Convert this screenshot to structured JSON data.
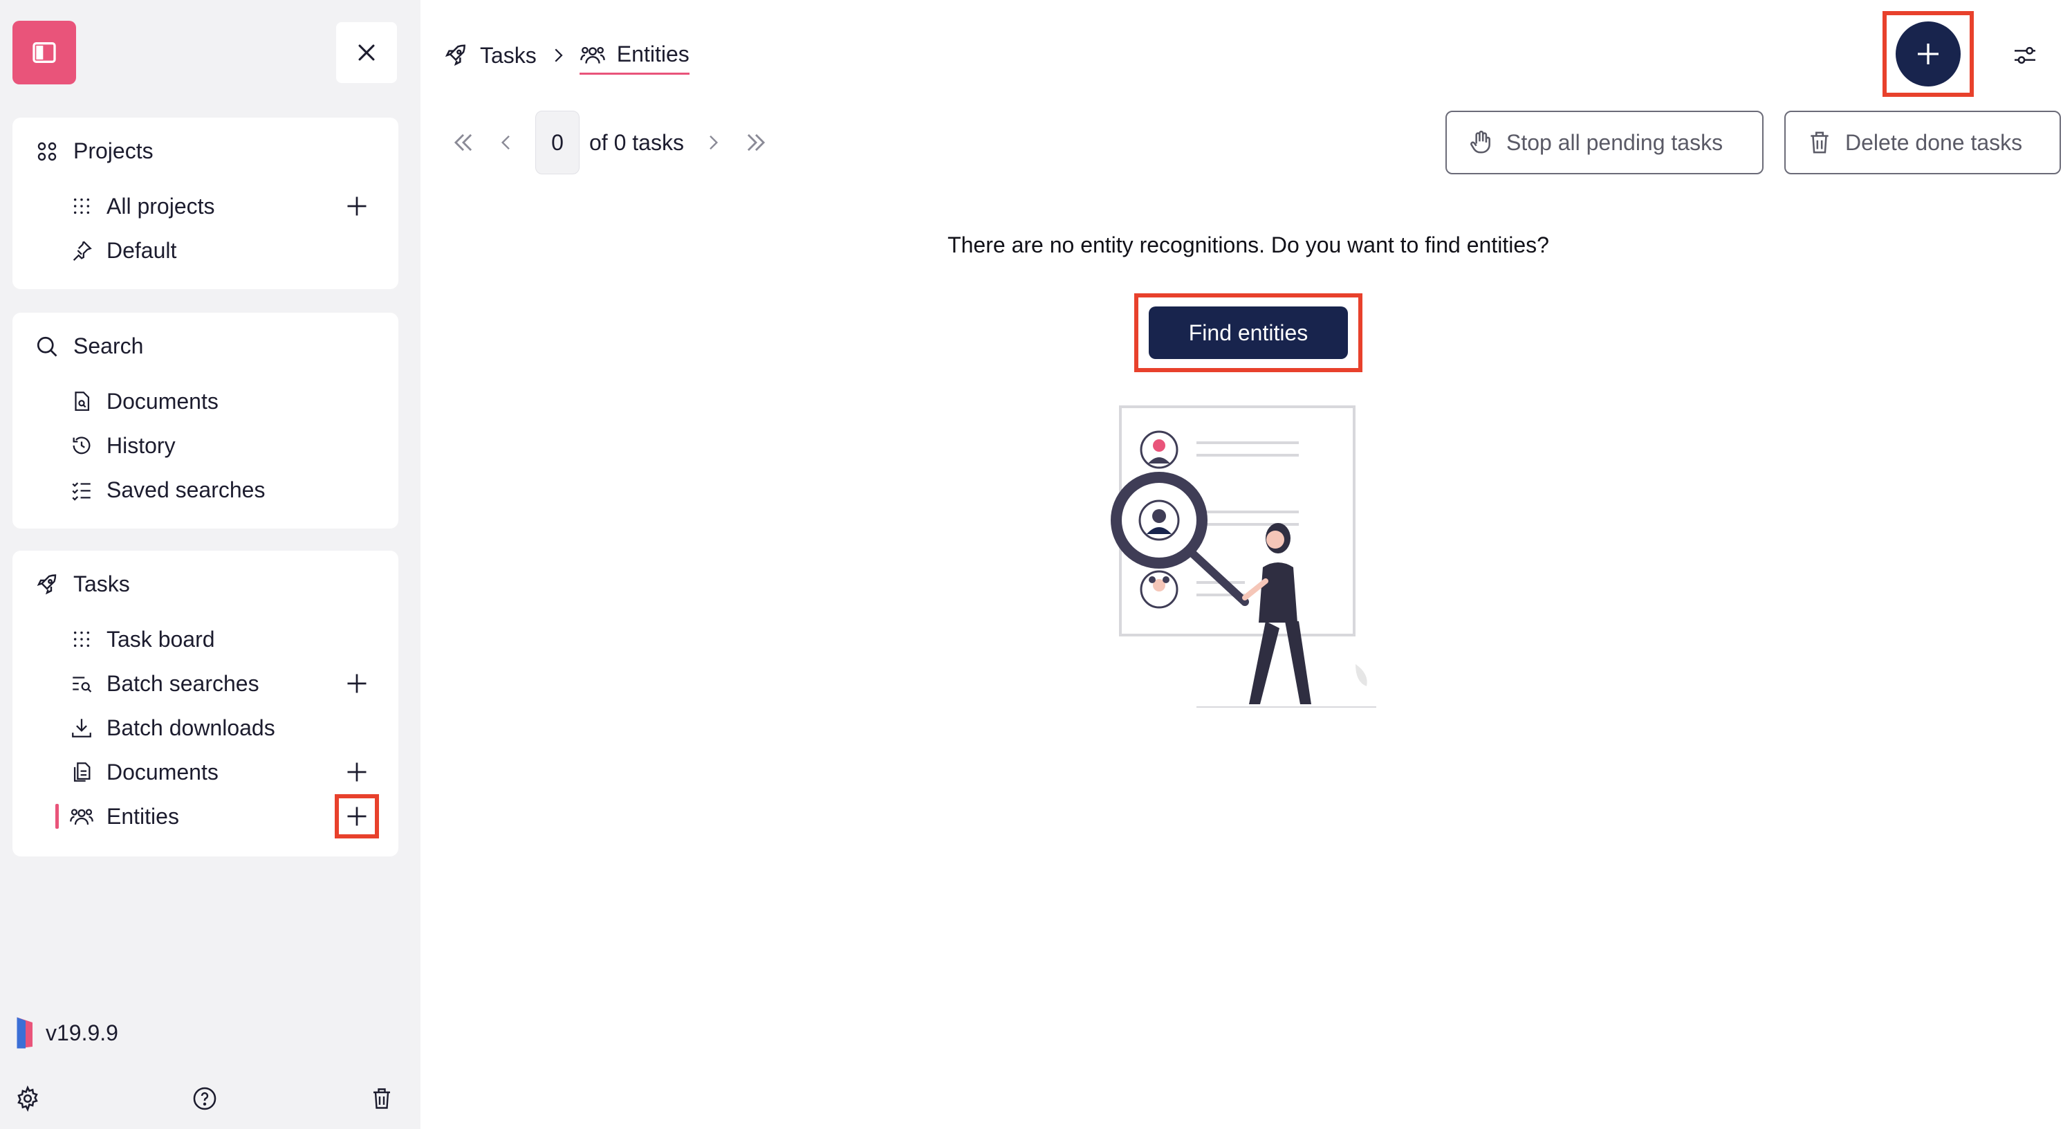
{
  "sidebar": {
    "projects": {
      "title": "Projects",
      "items": [
        {
          "label": "All projects"
        },
        {
          "label": "Default"
        }
      ]
    },
    "search": {
      "title": "Search",
      "items": [
        {
          "label": "Documents"
        },
        {
          "label": "History"
        },
        {
          "label": "Saved searches"
        }
      ]
    },
    "tasks": {
      "title": "Tasks",
      "items": [
        {
          "label": "Task board"
        },
        {
          "label": "Batch searches"
        },
        {
          "label": "Batch downloads"
        },
        {
          "label": "Documents"
        },
        {
          "label": "Entities"
        }
      ]
    },
    "version": "v19.9.9"
  },
  "breadcrumb": {
    "parent": "Tasks",
    "current": "Entities"
  },
  "pager": {
    "page": "0",
    "of_label": "of 0 tasks"
  },
  "actions": {
    "stop_pending": "Stop all pending tasks",
    "delete_done": "Delete done tasks"
  },
  "empty_state": {
    "message": "There are no entity recognitions. Do you want to find entities?",
    "button": "Find entities"
  },
  "colors": {
    "brand": "#e9547a",
    "primary": "#18244d",
    "highlight": "#e8412c",
    "sidebar_bg": "#f2f2f4"
  }
}
